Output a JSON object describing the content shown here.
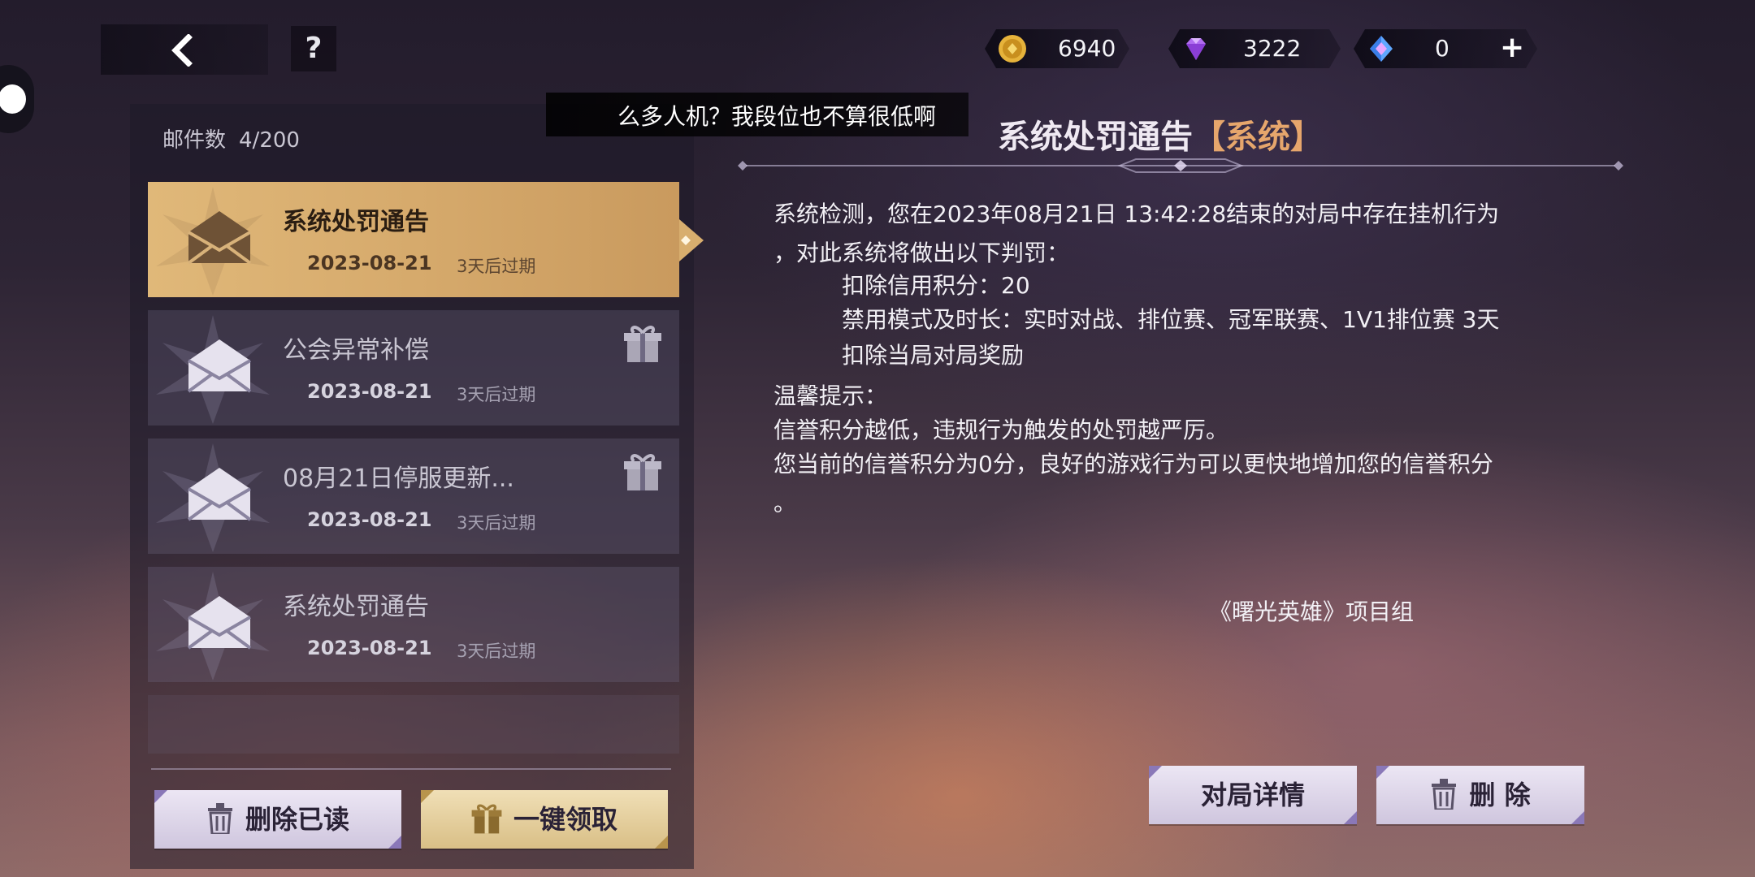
{
  "top": {
    "help_label": "?"
  },
  "currencies": [
    {
      "icon": "gold-coin-icon",
      "value": "6940"
    },
    {
      "icon": "purple-diamond-icon",
      "value": "3222"
    },
    {
      "icon": "blue-crystal-icon",
      "value": "0"
    }
  ],
  "add_label": "+",
  "toast": "么多人机？我段位也不算很低啊",
  "mailbox": {
    "count_label": "邮件数",
    "count_value": "4/200",
    "items": [
      {
        "title": "系统处罚通告",
        "date": "2023-08-21",
        "expire": "3天后过期",
        "has_gift": false,
        "selected": true
      },
      {
        "title": "公会异常补偿",
        "date": "2023-08-21",
        "expire": "3天后过期",
        "has_gift": true,
        "selected": false
      },
      {
        "title": "08月21日停服更新...",
        "date": "2023-08-21",
        "expire": "3天后过期",
        "has_gift": true,
        "selected": false
      },
      {
        "title": "系统处罚通告",
        "date": "2023-08-21",
        "expire": "3天后过期",
        "has_gift": false,
        "selected": false
      }
    ],
    "delete_read_label": "删除已读",
    "claim_all_label": "一键领取"
  },
  "mail": {
    "title": "系统处罚通告",
    "tag": "【系统】",
    "lines": [
      "系统检测，您在2023年08月21日 13:42:28结束的对局中存在挂机行为",
      "，对此系统将做出以下判罚：",
      "扣除信用积分：20",
      "禁用模式及时长：实时对战、排位赛、冠军联赛、1V1排位赛 3天",
      "扣除当局对局奖励",
      "温馨提示：",
      "信誉积分越低，违规行为触发的处罚越严厉。",
      "您当前的信誉积分为0分，良好的游戏行为可以更快地增加您的信誉积分",
      "。"
    ],
    "signature": "《曙光英雄》项目组",
    "detail_label": "对局详情",
    "delete_label": "删 除"
  }
}
